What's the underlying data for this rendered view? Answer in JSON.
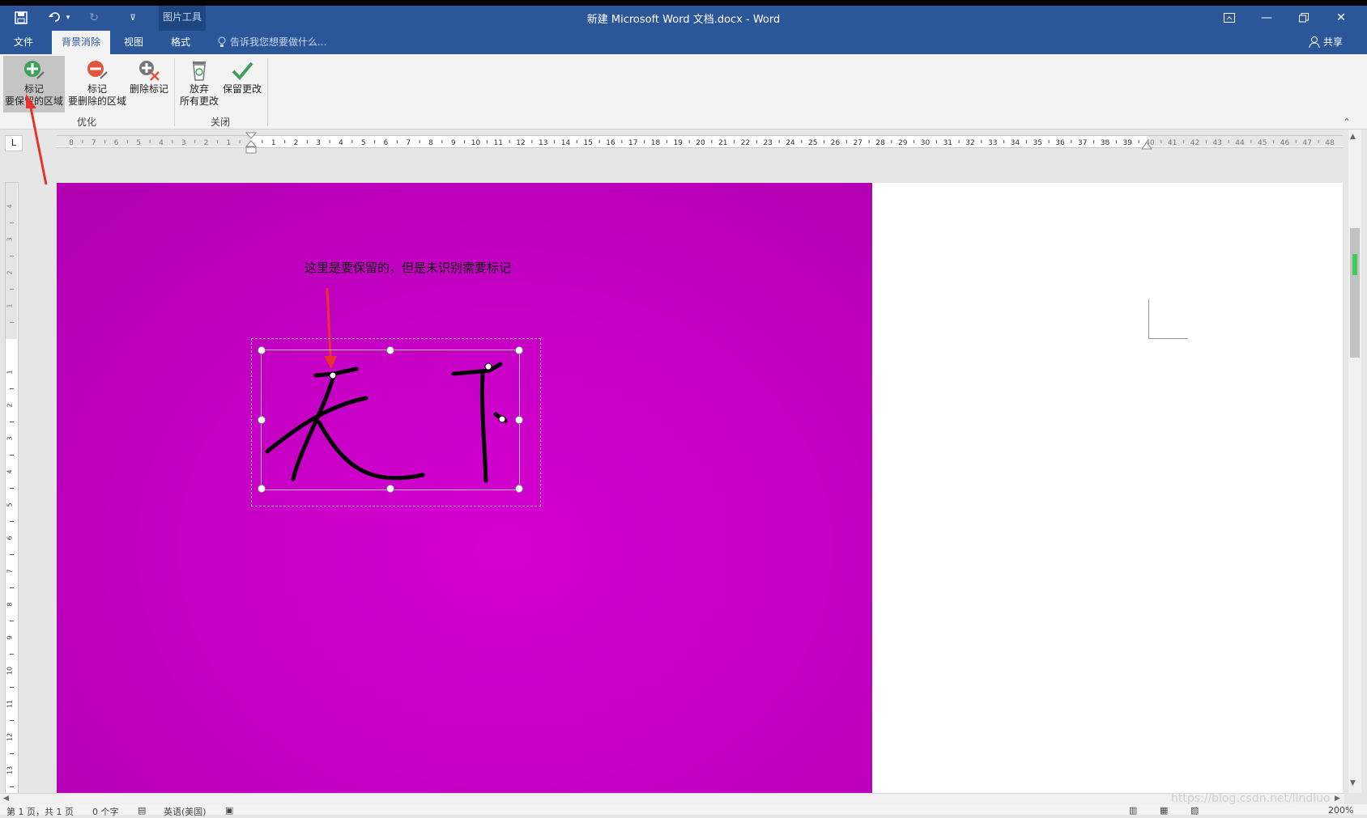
{
  "window": {
    "title": "新建 Microsoft Word 文档.docx - Word",
    "context_group": "图片工具"
  },
  "tabs": [
    {
      "label": "文件"
    },
    {
      "label": "背景消除",
      "active": true
    },
    {
      "label": "视图"
    },
    {
      "label": "格式"
    }
  ],
  "tell_me": "告诉我您想要做什么...",
  "share": "共享",
  "ribbon": {
    "keep_area": {
      "line1": "标记",
      "line2": "要保留的区域"
    },
    "remove_area": {
      "line1": "标记",
      "line2": "要删除的区域"
    },
    "delete_mark": {
      "label": "删除标记"
    },
    "discard": {
      "line1": "放弃",
      "line2": "所有更改"
    },
    "keep_changes": {
      "label": "保留更改"
    },
    "group_refine": "优化",
    "group_close": "关闭"
  },
  "ruler": {
    "tab_selector": "L",
    "left_ticks": [
      "8",
      "7",
      "6",
      "5",
      "4",
      "3",
      "2",
      "1"
    ],
    "right_ticks": [
      "1",
      "2",
      "3",
      "4",
      "5",
      "6",
      "7",
      "8",
      "9",
      "10",
      "11",
      "12",
      "13",
      "14",
      "15",
      "16",
      "17",
      "18",
      "19",
      "20",
      "21",
      "22",
      "23",
      "24",
      "25",
      "26",
      "27",
      "28",
      "29",
      "30",
      "31",
      "32",
      "33",
      "34",
      "35",
      "36",
      "37",
      "38",
      "39",
      "40",
      "41",
      "42",
      "43",
      "44",
      "45",
      "46",
      "47",
      "48"
    ],
    "vertical_top": [
      "4",
      "3",
      "2",
      "1"
    ],
    "vertical_bottom": [
      "1",
      "2",
      "3",
      "4",
      "5",
      "6",
      "7",
      "8",
      "9",
      "10",
      "11",
      "12",
      "13"
    ]
  },
  "document": {
    "annotation": "这里是要保留的，但是未识别需要标记",
    "image_characters": "天下"
  },
  "status": {
    "page": "第 1 页，共 1 页",
    "words": "0 个字",
    "language": "英语(美国)",
    "zoom": "200%"
  },
  "watermark": "https://blog.csdn.net/lindluo"
}
